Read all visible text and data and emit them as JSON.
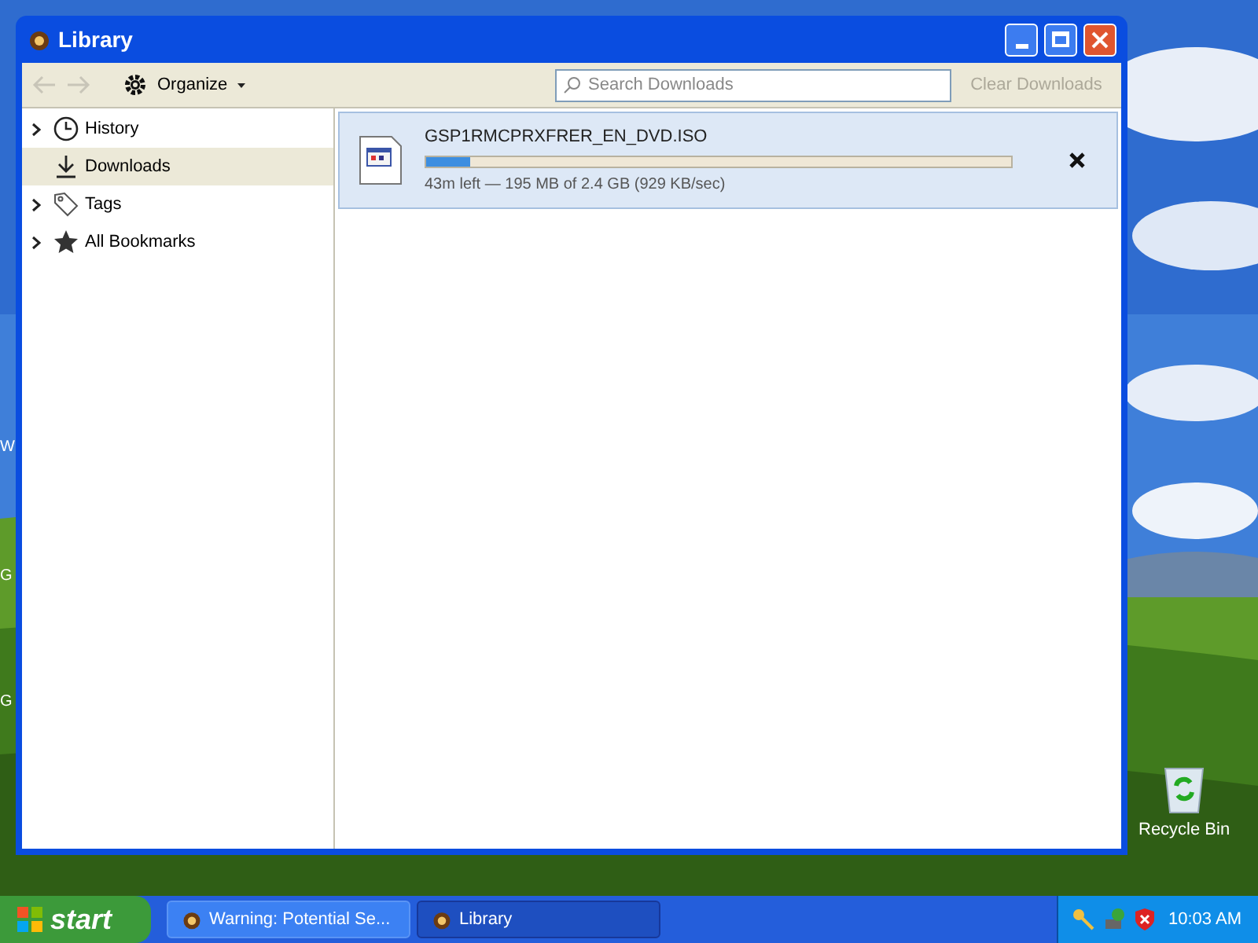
{
  "window": {
    "title": "Library"
  },
  "toolbar": {
    "organize": "Organize",
    "search_placeholder": "Search Downloads",
    "clear_button": {
      "label": "Clear Downloads",
      "disabled": true
    }
  },
  "sidebar": {
    "items": [
      {
        "label": "History",
        "kind": "history",
        "expandable": true,
        "selected": false
      },
      {
        "label": "Downloads",
        "kind": "downloads",
        "expandable": false,
        "selected": true
      },
      {
        "label": "Tags",
        "kind": "tags",
        "expandable": true,
        "selected": false
      },
      {
        "label": "All Bookmarks",
        "kind": "bookmarks",
        "expandable": true,
        "selected": false
      }
    ]
  },
  "downloads": [
    {
      "filename": "GSP1RMCPRXFRER_EN_DVD.ISO",
      "level": 0.075,
      "status": "43m left — 195 MB of 2.4 GB (929 KB/sec)",
      "selected": true
    }
  ],
  "desktop": {
    "icons": [
      {
        "label": "Recycle Bin"
      }
    ],
    "edge_labels": [
      "W",
      "G",
      "G"
    ]
  },
  "taskbar": {
    "start": "start",
    "tasks": [
      {
        "label": "Warning: Potential Se...",
        "selected": false
      },
      {
        "label": "Library",
        "selected": true
      }
    ],
    "clock": "10:03 AM"
  }
}
